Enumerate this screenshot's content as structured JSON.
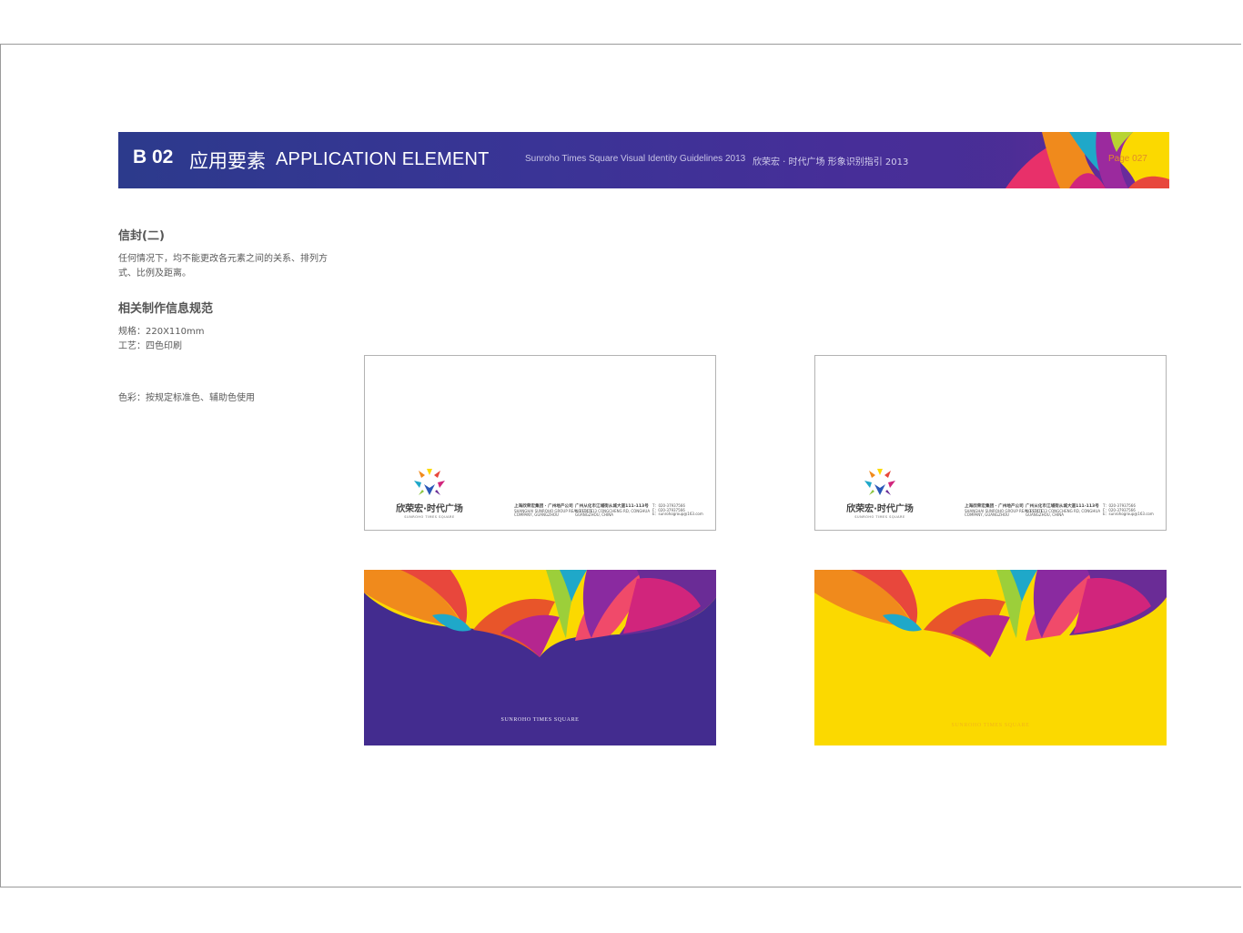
{
  "header": {
    "code": "B 02",
    "title_cn": "应用要素",
    "title_en": "APPLICATION ELEMENT",
    "subtitle_en": "Sunroho Times Square Visual Identity Guidelines 2013",
    "subtitle_cn": "欣荣宏 · 时代广场 形象识别指引  2013",
    "page": "Page 027"
  },
  "sidebar": {
    "section_title": "信封(二)",
    "note": "任何情况下，均不能更改各元素之间的关系、排列方式、比例及距离。",
    "spec_title": "相关制作信息规范",
    "spec_size": "规格：220X110mm",
    "spec_craft": "工艺：四色印刷",
    "spec_color": "色彩：按规定标准色、辅助色使用"
  },
  "envelope": {
    "logo_cn": "欣荣宏·时代广场",
    "logo_en": "SUNROHO TIMES SQUARE",
    "company": "上海欣荣宏集团 · 广州地产公司",
    "company_en_1": "SHANGHAI SUNROHO GROUP REAL ESTATE",
    "company_en_2": "COMPANY, GUANGZHOU",
    "address": "广州从化市江埔街从城大道111-113号",
    "address_en_1": "NO.111-113 CONGCHENG RD, CONGHUA",
    "address_en_2": "GUANGZHOU, CHINA",
    "tel": "T：020-37937566",
    "fax": "F：020-37937566",
    "email": "E：sunrohogroup@163.com",
    "front_label": "SUNROHO TIMES SQUARE"
  },
  "colors": {
    "purple": "#432c8f",
    "yellow": "#fbd900",
    "orange": "#f08a1c",
    "magenta": "#d1257c",
    "cyan": "#1fa8c9",
    "red": "#e8473c"
  }
}
